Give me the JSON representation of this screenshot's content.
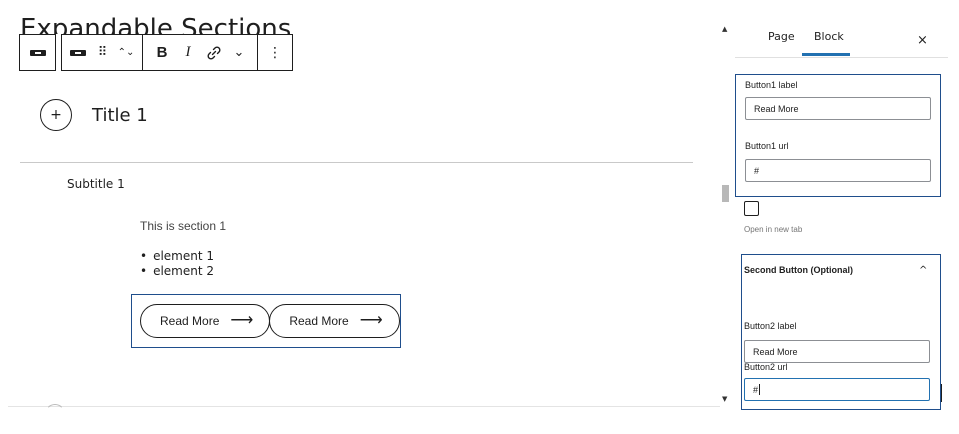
{
  "editor": {
    "page_heading": "Expandable Sections",
    "toolbar": {
      "bold": "B",
      "italic": "I",
      "link": "🔗",
      "more": "⌄",
      "options": "⋮",
      "move": "⌃⌄",
      "drag": "⠿"
    },
    "title_plus": "+",
    "title": "Title 1",
    "subtitle": "Subtitle 1",
    "section_text": "This is section 1",
    "list_items": [
      "element 1",
      "element 2"
    ],
    "buttons": [
      {
        "label": "Read More",
        "arrow": "⟶"
      },
      {
        "label": "Read More",
        "arrow": "⟶"
      }
    ]
  },
  "sidebar": {
    "tabs": {
      "page": "Page",
      "block": "Block",
      "active": "Block"
    },
    "close": "×",
    "button1": {
      "label_title": "Button1 label",
      "label_value": "Read More",
      "url_title": "Button1 url",
      "url_value": "#"
    },
    "open_new_tab": {
      "checked": false,
      "help": "Open in new tab"
    },
    "second_button": {
      "panel_title": "Second Button (Optional)",
      "chevron": "^",
      "label_title": "Button2 label",
      "label_value": "Read More",
      "url_title": "Button2 url",
      "url_value": "#"
    }
  },
  "scrollbar": {
    "up": "▲",
    "down": "▼"
  },
  "colors": {
    "accent": "#2271b1",
    "selection": "#1f4e8c",
    "text": "#1e1e1e"
  }
}
